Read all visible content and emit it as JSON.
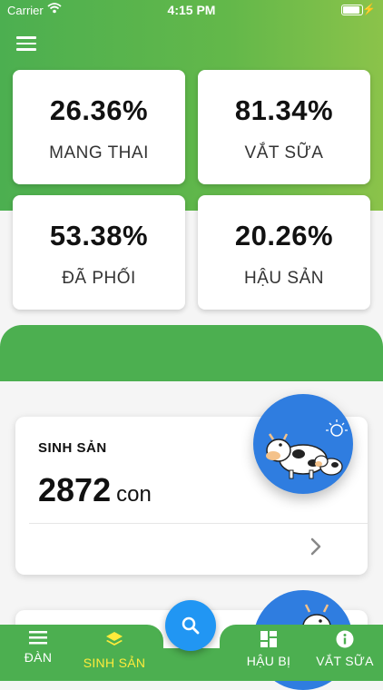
{
  "status_bar": {
    "carrier": "Carrier",
    "time": "4:15 PM"
  },
  "stats": [
    {
      "value": "26.36%",
      "label": "MANG THAI"
    },
    {
      "value": "81.34%",
      "label": "VẮT SỮA"
    },
    {
      "value": "53.38%",
      "label": "ĐÃ PHỐI"
    },
    {
      "value": "20.26%",
      "label": "HẬU SẢN"
    }
  ],
  "reproduction": {
    "title": "SINH SẢN",
    "count": "2872",
    "unit": "con"
  },
  "bottom_nav": [
    {
      "label": "ĐÀN",
      "icon": "menu-icon"
    },
    {
      "label": "SINH SẢN",
      "icon": "layers-icon",
      "active": true
    },
    {
      "label": "HẬU BỊ",
      "icon": "grid-icon"
    },
    {
      "label": "VẮT SỮA",
      "icon": "info-icon"
    }
  ],
  "colors": {
    "primary": "#4caf50",
    "accent": "#2196f3",
    "active_nav": "#ffeb3b"
  }
}
